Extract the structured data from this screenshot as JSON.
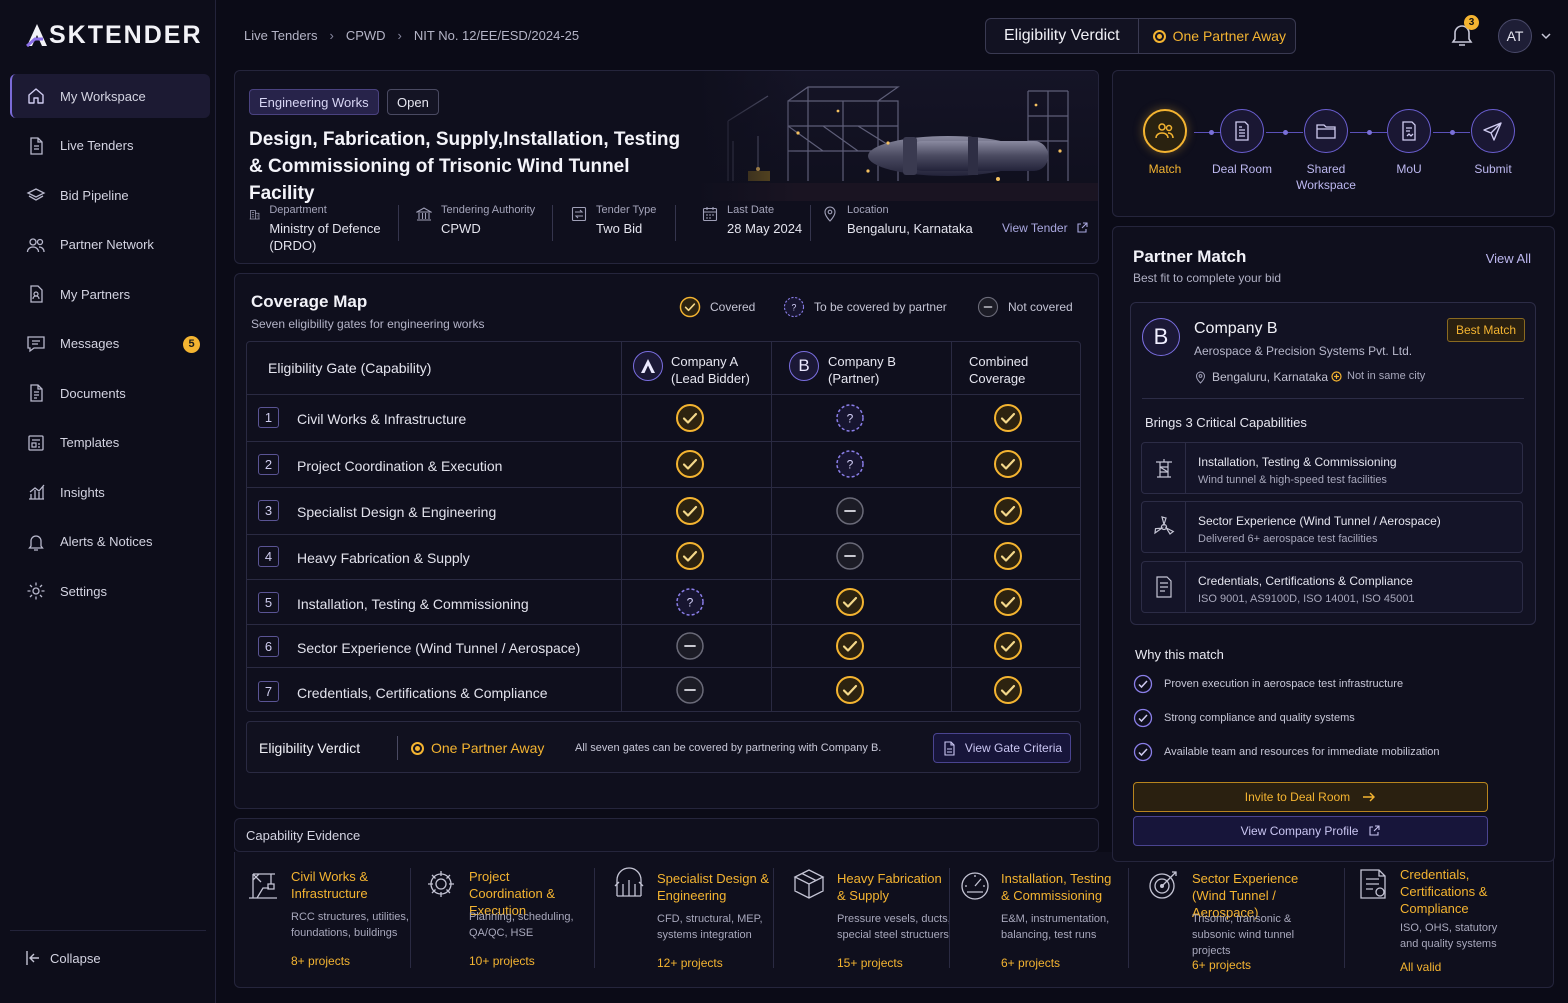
{
  "brand": {
    "name": "SKTENDER"
  },
  "sidebar": {
    "items": [
      {
        "label": "My Workspace",
        "icon": "home-icon"
      },
      {
        "label": "Live Tenders",
        "icon": "document-icon"
      },
      {
        "label": "Bid Pipeline",
        "icon": "layers-icon"
      },
      {
        "label": "Partner Network",
        "icon": "users-icon"
      },
      {
        "label": "My Partners",
        "icon": "partner-doc-icon"
      },
      {
        "label": "Messages",
        "icon": "message-icon",
        "badge": "5"
      },
      {
        "label": "Documents",
        "icon": "file-icon"
      },
      {
        "label": "Templates",
        "icon": "template-icon"
      },
      {
        "label": "Insights",
        "icon": "chart-icon"
      },
      {
        "label": "Alerts & Notices",
        "icon": "bell-icon"
      },
      {
        "label": "Settings",
        "icon": "gear-icon"
      }
    ],
    "collapse_label": "Collapse"
  },
  "header": {
    "breadcrumb": [
      "Live Tenders",
      "CPWD",
      "NIT No. 12/EE/ESD/2024-25"
    ],
    "verdict_label": "Eligibility Verdict",
    "verdict_value": "One Partner Away",
    "notification_count": "3",
    "avatar_initials": "AT"
  },
  "tender": {
    "tags": [
      "Engineering Works",
      "Open"
    ],
    "title": "Design, Fabrication, Supply,Installation, Testing & Commissioning of Trisonic Wind Tunnel Facility",
    "meta": [
      {
        "key": "Department",
        "value": "Ministry of Defence (DRDO)",
        "icon": "building-icon"
      },
      {
        "key": "Tendering Authority",
        "value": "CPWD",
        "icon": "bank-icon"
      },
      {
        "key": "Tender Type",
        "value": "Two Bid",
        "icon": "swap-icon"
      },
      {
        "key": "Last Date",
        "value": "28 May 2024",
        "icon": "calendar-icon"
      },
      {
        "key": "Location",
        "value": "Bengaluru, Karnataka",
        "icon": "pin-icon"
      }
    ],
    "view_tender_label": "View Tender"
  },
  "coverage": {
    "title": "Coverage Map",
    "subtitle": "Seven eligibility gates for engineering works",
    "legend": [
      "Covered",
      "To be covered by partner",
      "Not covered"
    ],
    "headers": {
      "gate": "Eligibility Gate (Capability)",
      "company_a": "Company A",
      "company_a_role": "(Lead Bidder)",
      "company_b": "Company B",
      "company_b_role": "(Partner)",
      "combined": "Combined",
      "combined_2": "Coverage"
    },
    "rows": [
      {
        "num": "1",
        "name": "Civil Works & Infrastructure",
        "a": "covered",
        "b": "partner",
        "c": "covered"
      },
      {
        "num": "2",
        "name": "Project Coordination & Execution",
        "a": "covered",
        "b": "partner",
        "c": "covered"
      },
      {
        "num": "3",
        "name": "Specialist Design & Engineering",
        "a": "covered",
        "b": "none",
        "c": "covered"
      },
      {
        "num": "4",
        "name": "Heavy Fabrication & Supply",
        "a": "covered",
        "b": "none",
        "c": "covered"
      },
      {
        "num": "5",
        "name": "Installation, Testing & Commissioning",
        "a": "partner",
        "b": "covered",
        "c": "covered"
      },
      {
        "num": "6",
        "name": "Sector Experience  (Wind Tunnel / Aerospace)",
        "a": "none",
        "b": "covered",
        "c": "covered"
      },
      {
        "num": "7",
        "name": "Credentials, Certifications & Compliance",
        "a": "none",
        "b": "covered",
        "c": "covered"
      }
    ],
    "verdict": {
      "label": "Eligibility Verdict",
      "value": "One Partner Away",
      "text": "All seven gates can be covered by partnering with Company B.",
      "button": "View Gate Criteria"
    }
  },
  "evidence": {
    "header": "Capability Evidence",
    "items": [
      {
        "title": "Civil Works & Infrastructure",
        "desc": "RCC structures, utilities, foundations, buildings",
        "count": "8+ projects",
        "icon": "crane-icon"
      },
      {
        "title": "Project Coordination & Execution",
        "desc": "Planning, scheduling, QA/QC, HSE",
        "count": "10+ projects",
        "icon": "gear-icon"
      },
      {
        "title": "Specialist Design & Engineering",
        "desc": "CFD, structural, MEP, systems integration",
        "count": "12+ projects",
        "icon": "design-icon"
      },
      {
        "title": "Heavy Fabrication & Supply",
        "desc": "Pressure vesels, ducts, special steel structuers",
        "count": "15+ projects",
        "icon": "box-icon"
      },
      {
        "title": "Installation, Testing & Commissioning",
        "desc": "E&M, instrumentation, balancing, test runs",
        "count": "6+ projects",
        "icon": "gauge-icon"
      },
      {
        "title": "Sector Experience (Wind Tunnel / Aerospace)",
        "desc": "Trisonic, transonic & subsonic wind tunnel projects",
        "count": "6+ projects",
        "icon": "target-icon"
      },
      {
        "title": "Credentials, Certifications & Compliance",
        "desc": "ISO, OHS, statutory and quality systems",
        "count": "All valid",
        "icon": "certificate-icon"
      }
    ]
  },
  "flow": {
    "steps": [
      {
        "label": "Match",
        "icon": "users-icon",
        "active": true
      },
      {
        "label": "Deal Room",
        "icon": "building-doc-icon"
      },
      {
        "label": "Shared Workspace",
        "icon": "folder-icon"
      },
      {
        "label": "MoU",
        "icon": "contract-icon"
      },
      {
        "label": "Submit",
        "icon": "send-icon"
      }
    ]
  },
  "partner": {
    "title": "Partner Match",
    "subtitle": "Best fit to complete your bid",
    "view_all": "View All",
    "initial": "B",
    "name": "Company B",
    "full_name": "Aerospace & Precision Systems Pvt. Ltd.",
    "badge": "Best Match",
    "location": "Bengaluru, Karnataka",
    "city_note": "Not in same city",
    "brings": "Brings 3 Critical Capabilities",
    "capabilities": [
      {
        "title": "Installation, Testing & Commissioning",
        "desc": "Wind tunnel & high-speed test facilities",
        "icon": "tower-icon"
      },
      {
        "title": "Sector Experience (Wind Tunnel / Aerospace)",
        "desc": "Delivered 6+ aerospace test facilities",
        "icon": "turbine-icon"
      },
      {
        "title": "Credentials, Certifications & Compliance",
        "desc": "ISO 9001, AS9100D, ISO 14001, ISO 45001",
        "icon": "doc-icon"
      }
    ],
    "why_title": "Why this match",
    "reasons": [
      "Proven execution in aerospace test infrastructure",
      "Strong compliance and quality systems",
      "Available team and resources for immediate mobilization"
    ],
    "invite_label": "Invite to Deal Room",
    "profile_label": "View Company Profile"
  },
  "colors": {
    "accent": "#f4b431",
    "brand": "#7b6bd8",
    "bg": "#0b0b17"
  }
}
